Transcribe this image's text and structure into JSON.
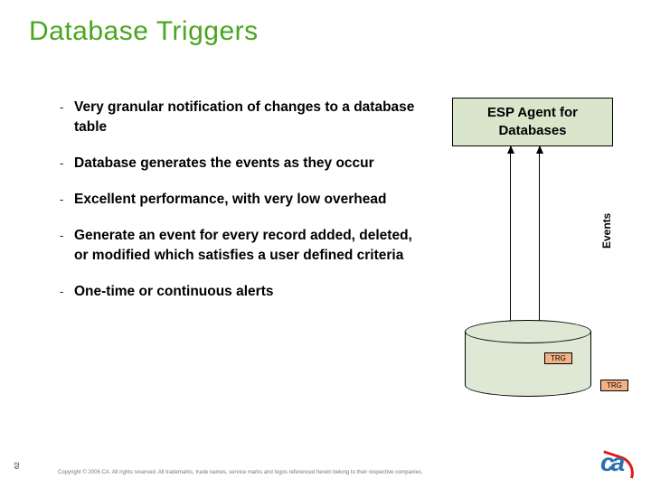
{
  "title": "Database Triggers",
  "bullets": {
    "b1": "Very granular notification of changes to a database table",
    "b2": "Database generates the events as they occur",
    "b3": "Excellent performance, with very low overhead",
    "b4": "Generate an event for every record added, deleted, or modified which satisfies a user defined criteria",
    "b5": "One-time or continuous alerts"
  },
  "diagram": {
    "esp_box_line1": "ESP Agent for",
    "esp_box_line2": "Databases",
    "events_label": "Events",
    "trg1": "TRG",
    "trg2": "TRG"
  },
  "footer": {
    "copyright": "Copyright © 2006 CA. All rights reserved. All trademarks, trade names, service marks and logos referenced herein belong to their respective companies.",
    "page": "62"
  },
  "logo_text": "ca"
}
